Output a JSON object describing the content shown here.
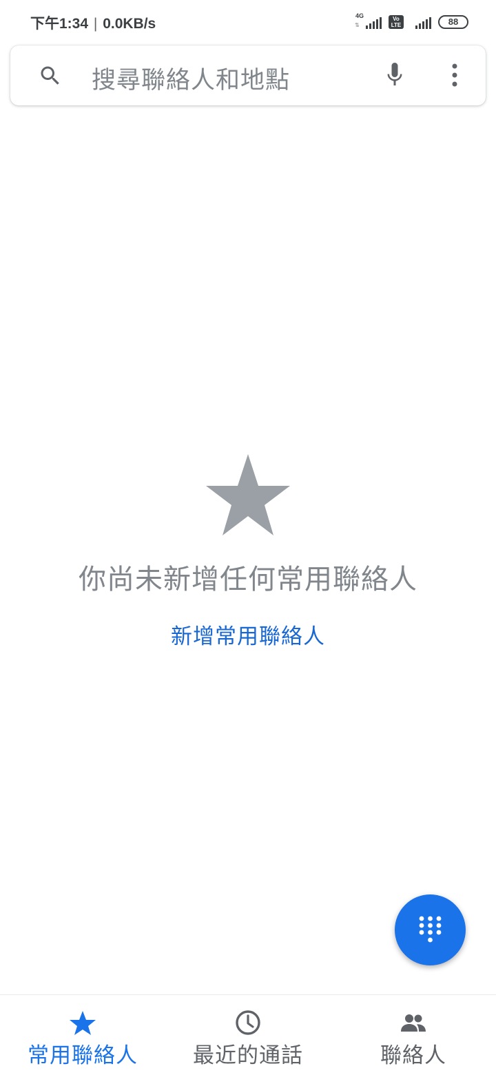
{
  "status_bar": {
    "time": "下午1:34",
    "separator": "|",
    "net_speed": "0.0KB/s",
    "network_type": "4G",
    "volte_line1": "Vo",
    "volte_line2": "LTE",
    "battery": "88"
  },
  "search": {
    "placeholder": "搜尋聯絡人和地點",
    "icons": [
      "search-icon",
      "mic-icon",
      "more-vert-icon"
    ]
  },
  "empty_state": {
    "icon": "star-icon",
    "message": "你尚未新增任何常用聯絡人",
    "action_label": "新增常用聯絡人"
  },
  "fab": {
    "icon": "dialpad-icon"
  },
  "bottom_nav": {
    "items": [
      {
        "label": "常用聯絡人",
        "icon": "star-icon",
        "active": true
      },
      {
        "label": "最近的通話",
        "icon": "clock-icon",
        "active": false
      },
      {
        "label": "聯絡人",
        "icon": "people-icon",
        "active": false
      }
    ]
  },
  "colors": {
    "accent": "#1a73e8",
    "link": "#1967d2",
    "muted_text": "#80868b",
    "icon_gray": "#5f6368",
    "empty_star": "#9aa0a6"
  }
}
